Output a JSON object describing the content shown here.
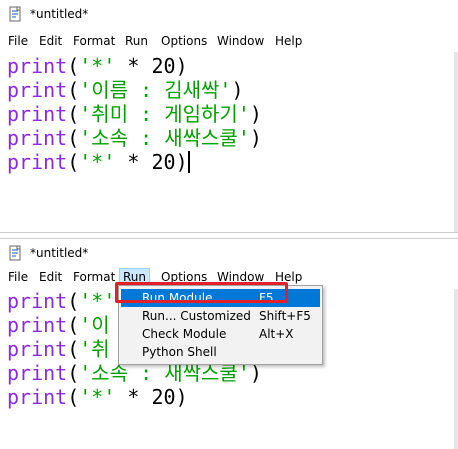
{
  "windows": [
    {
      "title": "*untitled*",
      "menu": [
        "File",
        "Edit",
        "Format",
        "Run",
        "Options",
        "Window",
        "Help"
      ],
      "code": [
        {
          "kw": "print",
          "open": "(",
          "str": "'*'",
          "rest": " * 20)"
        },
        {
          "kw": "print",
          "open": "(",
          "str": "'이름 : 김새싹'",
          "rest": ")"
        },
        {
          "kw": "print",
          "open": "(",
          "str": "'취미 : 게임하기'",
          "rest": ")"
        },
        {
          "kw": "print",
          "open": "(",
          "str": "'소속 : 새싹스쿨'",
          "rest": ")"
        },
        {
          "kw": "print",
          "open": "(",
          "str": "'*'",
          "rest": " * 20)"
        }
      ]
    },
    {
      "title": "*untitled*",
      "menu": [
        "File",
        "Edit",
        "Format",
        "Run",
        "Options",
        "Window",
        "Help"
      ],
      "active_menu": "Run",
      "code": [
        {
          "kw": "print",
          "open": "(",
          "str": "'*'",
          "rest": ""
        },
        {
          "kw": "print",
          "open": "(",
          "str": "'이",
          "rest": ""
        },
        {
          "kw": "print",
          "open": "(",
          "str": "'취",
          "rest": ""
        },
        {
          "kw": "print",
          "open": "(",
          "str": "'소속 : 새싹스쿨'",
          "rest": ")"
        },
        {
          "kw": "print",
          "open": "(",
          "str": "'*'",
          "rest": " * 20)"
        }
      ]
    }
  ],
  "run_menu": {
    "items": [
      {
        "label": "Run Module",
        "shortcut": "F5",
        "highlighted": true
      },
      {
        "label": "Run... Customized",
        "shortcut": "Shift+F5"
      },
      {
        "label": "Check Module",
        "shortcut": "Alt+X"
      },
      {
        "label": "Python Shell",
        "shortcut": ""
      }
    ]
  },
  "colors": {
    "keyword": "#8a2be2",
    "string": "#00a000",
    "highlight": "#0078d7",
    "callout": "#e0202a"
  },
  "icons": {
    "file": "document-icon"
  }
}
